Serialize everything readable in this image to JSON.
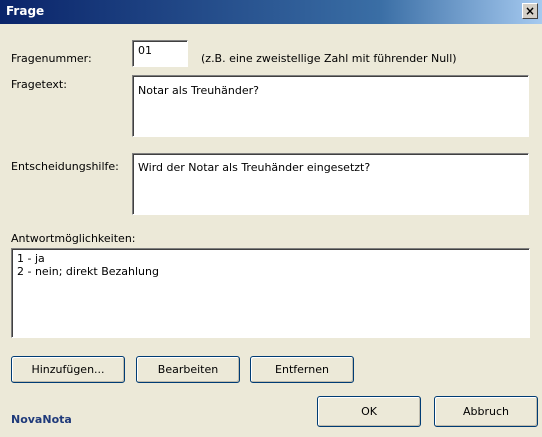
{
  "window": {
    "title": "Frage",
    "close_glyph": "×"
  },
  "fields": {
    "number": {
      "label": "Fragenummer:",
      "value": "01",
      "hint": "(z.B. eine zweistellige Zahl mit führender Null)"
    },
    "question_text": {
      "label": "Fragetext:",
      "value": "Notar als Treuhänder?"
    },
    "decision_help": {
      "label": "Entscheidungshilfe:",
      "value": "Wird der Notar als Treuhänder eingesetzt?"
    },
    "answers": {
      "label": "Antwortmöglichkeiten:",
      "items": [
        "1 - ja",
        "2 - nein; direkt Bezahlung"
      ]
    }
  },
  "buttons": {
    "add": "Hinzufügen...",
    "edit": "Bearbeiten",
    "remove": "Entfernen",
    "ok": "OK",
    "cancel": "Abbruch"
  },
  "brand": "NovaNota"
}
